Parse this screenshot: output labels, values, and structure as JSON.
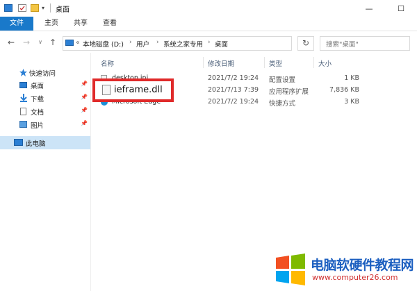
{
  "window": {
    "title": "桌面",
    "minimize": "—",
    "maximize": "☐"
  },
  "ribbon": {
    "tabs": [
      "文件",
      "主页",
      "共享",
      "查看"
    ]
  },
  "address": {
    "overflow": "«",
    "crumbs": [
      "本地磁盘 (D:)",
      "用户",
      "系统之家专用",
      "桌面"
    ],
    "search_placeholder": "搜索\"桌面\""
  },
  "sidebar": {
    "quick_access": "快速访问",
    "items": [
      "桌面",
      "下载",
      "文档",
      "图片"
    ],
    "this_pc": "此电脑"
  },
  "columns": {
    "name": "名称",
    "date": "修改日期",
    "type": "类型",
    "size": "大小"
  },
  "files": [
    {
      "name": "desktop.ini",
      "date": "2021/7/2 19:24",
      "type": "配置设置",
      "size": "1 KB"
    },
    {
      "name": "ieframe.dll",
      "date": "2021/7/13 7:39",
      "type": "应用程序扩展",
      "size": "7,836 KB"
    },
    {
      "name": "Microsoft Edge",
      "date": "2021/7/2 19:24",
      "type": "快捷方式",
      "size": "3 KB"
    }
  ],
  "watermark": {
    "line1": "电脑软硬件教程网",
    "line2": "www.computer26.com"
  },
  "colors": {
    "accent": "#1979ca",
    "highlight_border": "#e02a2a",
    "selected_nav": "#cce4f7"
  }
}
